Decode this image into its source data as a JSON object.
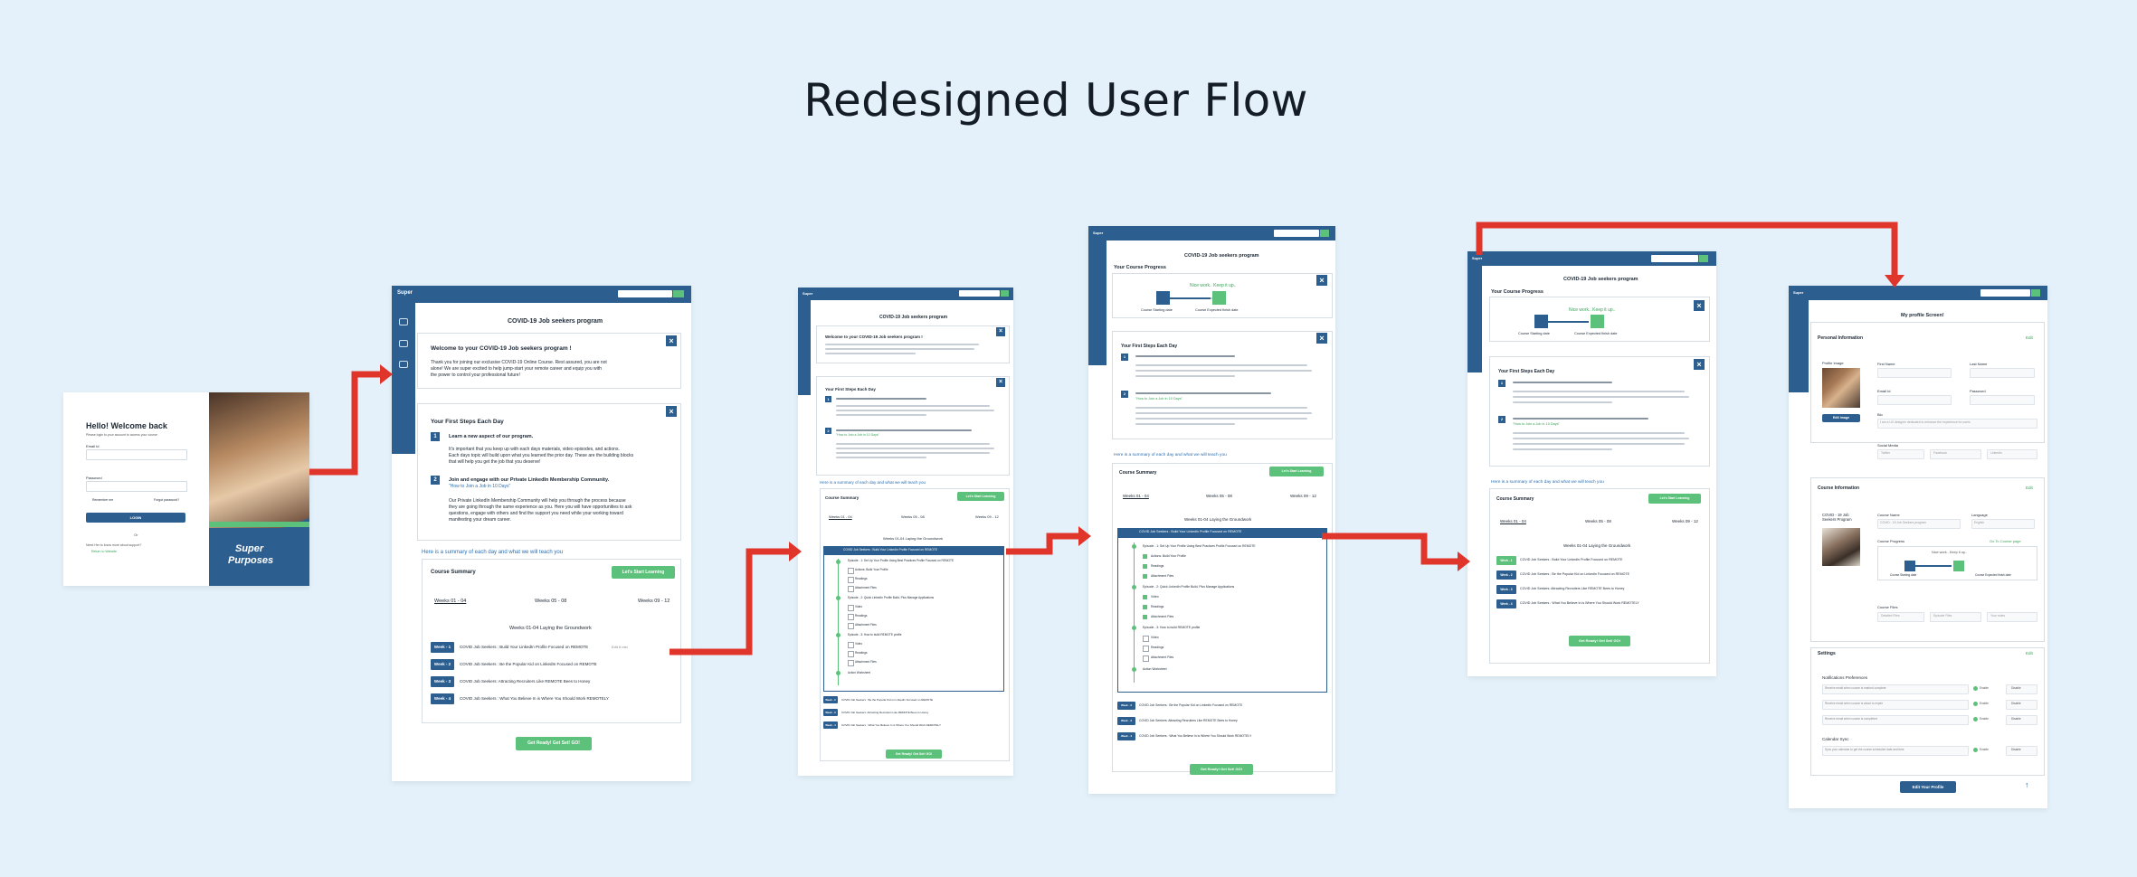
{
  "title": "Redesigned User Flow",
  "colors": {
    "background": "#e4f1fa",
    "brand_blue": "#2c5f8f",
    "accent_green": "#5cc17a",
    "arrow_red": "#e0352b"
  },
  "screen1": {
    "heading": "Hello! Welcome back",
    "subheading": "Please login to your account to access your course",
    "email_label": "Email Id",
    "password_label": "Password",
    "remember": "Remember me",
    "forgot": "Forgot password?",
    "login": "LOGIN",
    "or": "Or",
    "need_help": "Need Her to know more about support?",
    "return_website": "Return to Website",
    "brand_line1": "Super",
    "brand_line2": "Purposes"
  },
  "course": {
    "program_title": "COVID-19 Job seekers program",
    "welcome_title": "Welcome to your COVID-19 Job seekers program !",
    "welcome_body_1": "Thank you for joining our exclusive COVID-19 Online Course. Rest assured, you are not",
    "welcome_body_2": "alone! We are super excited to help jump-start your remote career and equip you with",
    "welcome_body_3": "the power to control your professional future!",
    "steps_title": "Your First Steps Each Day",
    "step1_title": "Learn a new aspect of our program.",
    "step1_body_1": "It's important that you keep up with each days materials, video episodes, and actions.",
    "step1_body_2": "Each days topic will build upon what you learned the prior day. These are the building blocks",
    "step1_body_3": "that will help you get the job that you deserve!",
    "step2_title": "Join and engage with our Private LinkedIn Membership Community.",
    "step2_link": "\"How to Join a Job in 10 Days\"",
    "step2_body_1": "Our Private LinkedIn Membership Community will help you through the process because",
    "step2_body_2": "they are going through the same experience as you. Here you will have opportunities to ask",
    "step2_body_3": "questions, engage with others and find the support you need while your working toward",
    "step2_body_4": "manifesting your dream career.",
    "summary_intro": "Here is a summary of each day and what we will teach you",
    "summary_title": "Course Summary",
    "lets_start": "Let's Start Learning",
    "tabs": [
      "Weeks 01 - 04",
      "Weeks 05 - 08",
      "Weeks 09 - 12"
    ],
    "weeks_heading": "Weeks 01-04 Laying the Groundwork",
    "weeks": [
      {
        "tag": "Week - 1",
        "text": "COVID Job Seekers : Build Your LinkedIn Profile Focused on REMOTE",
        "meta": "Edit 6 min"
      },
      {
        "tag": "Week - 2",
        "text": "COVID Job Seekers : Be the Popular Kid on LinkedIn Focused on REMOTE",
        "meta": ""
      },
      {
        "tag": "Week - 3",
        "text": "COVID Job Seekers: Attracting Recruiters Like REMOTE Bees to Honey",
        "meta": ""
      },
      {
        "tag": "Week - 4",
        "text": "COVID Job Seekers : What You Believe In is Where You Should Work REMOTELY",
        "meta": ""
      }
    ],
    "get_ready": "Get Ready! Get Set! GO!",
    "episodes": [
      "Episode - 1: Set Up Your Profile Using Best Practices Profile Focused on REMOTE",
      "Actions: Build Your Profile",
      "Readings",
      "Attachment Files",
      "Episode - 2: Quick LinkedIn Profile Build, Plus Manage Applications",
      "Video",
      "Readings",
      "Attachment Files",
      "Episode - 3: How to build REMOTE profile",
      "Video",
      "Readings",
      "Attachment Files",
      "Action Worksheet"
    ]
  },
  "progress": {
    "title": "Your Course Progress",
    "encourage": "Nice work.. Keep it up..",
    "start": "Course Starting date",
    "end": "Course Expected finish date",
    "check_in": "Let's Start Learning",
    "bar_value": 0.5
  },
  "profile": {
    "title": "My profile Screen!",
    "personal": "Personal Information",
    "edit": "Edit",
    "profile_image": "Profile Image",
    "first_name": "First Name",
    "last_name": "Last Name",
    "email": "Email Id",
    "password": "Password",
    "bio": "Bio",
    "bio_text": "I am a UX designer dedicated to enhance the experience for users",
    "social": "Social Media",
    "social_items": [
      "Twitter",
      "Facebook",
      "LinkedIn"
    ],
    "edit_image": "Edit Image",
    "course_info": "Course Information",
    "course_name_label": "Course Name",
    "course_name_value": "COVID - 19 Job Seekers program",
    "language_label": "Language",
    "language_value": "English",
    "course_progress": "Course Progress",
    "go_to_course": "Go To Course page",
    "course_files": "Course Files",
    "files": [
      "Detailed Files",
      "Episode Files",
      "Your notes"
    ],
    "course_thumb_label": "COVID - 19 Job Seekers Program",
    "settings": "Settings",
    "notif": "Notifications Preferences",
    "notif_rows": [
      "Receive email when course is marked complete",
      "Receive email when course is about to expire",
      "Receive email when course is completed"
    ],
    "enable": "Enable",
    "disable": "Disable",
    "calendar": "Calendar Sync",
    "calendar_row": "Sync your calendar to get the course scheduled date and time",
    "edit_profile": "Edit Your Profile"
  }
}
